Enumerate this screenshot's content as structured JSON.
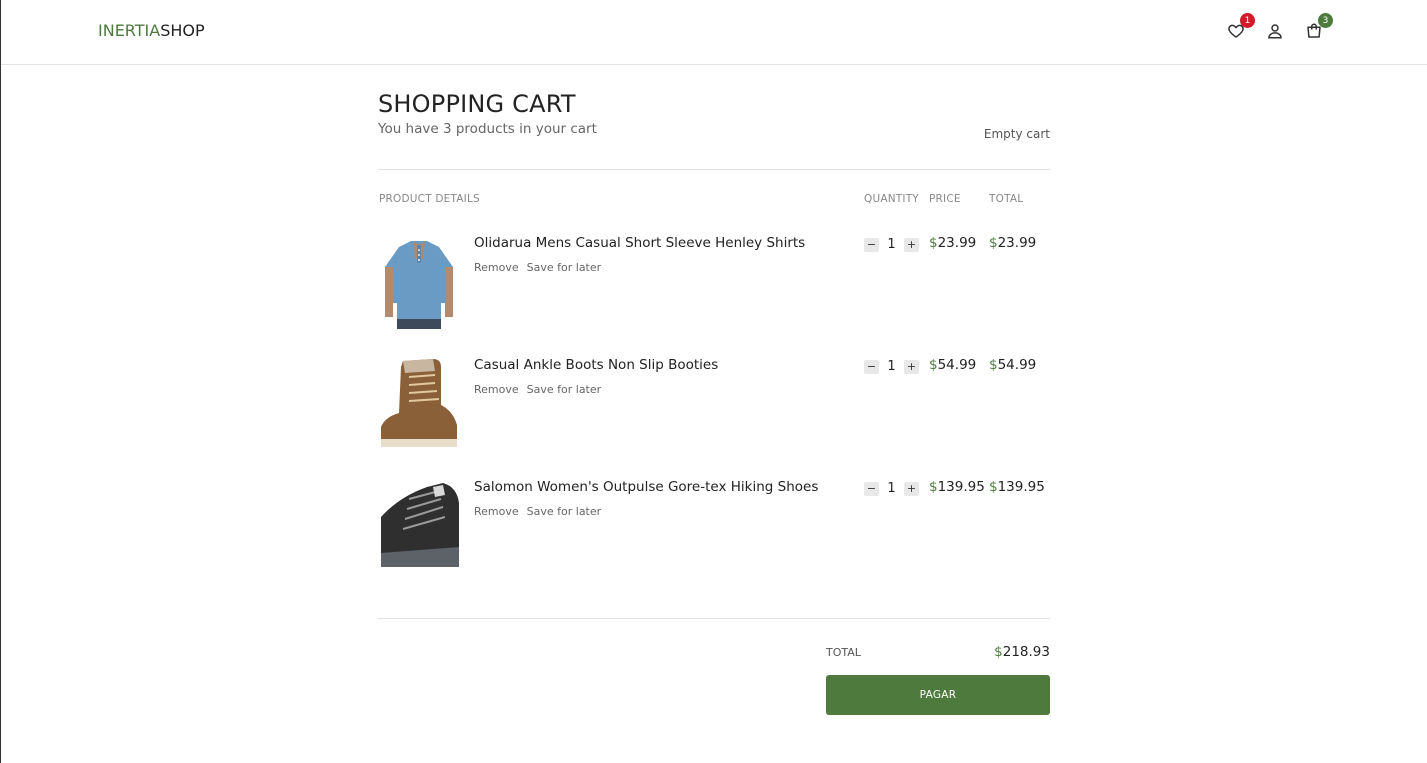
{
  "header": {
    "logo_part1": "INERTIA",
    "logo_part2": "SHOP",
    "wishlist_count": "1",
    "cart_count": "3",
    "icons": [
      "heart-icon",
      "user-icon",
      "shopping-bag-icon"
    ]
  },
  "cart": {
    "title": "SHOPPING CART",
    "subtitle": "You have 3 products in your cart",
    "empty_label": "Empty cart",
    "columns": {
      "product": "PRODUCT DETAILS",
      "quantity": "QUANTITY",
      "price": "PRICE",
      "total": "TOTAL"
    },
    "items": [
      {
        "name": "Olidarua Mens Casual Short Sleeve Henley Shirts",
        "remove": "Remove",
        "save": "Save for later",
        "qty": "1",
        "price": "23.99",
        "total": "23.99"
      },
      {
        "name": "Casual Ankle Boots Non Slip Booties",
        "remove": "Remove",
        "save": "Save for later",
        "qty": "1",
        "price": "54.99",
        "total": "54.99"
      },
      {
        "name": "Salomon Women's Outpulse Gore-tex Hiking Shoes",
        "remove": "Remove",
        "save": "Save for later",
        "qty": "1",
        "price": "139.95",
        "total": "139.95"
      }
    ],
    "currency": "$",
    "minus": "−",
    "plus": "+",
    "total_label": "TOTAL",
    "total_value": "218.93",
    "pay_label": "PAGAR"
  },
  "colors": {
    "accent": "#4e7a3e",
    "badge_red": "#d11a2a"
  }
}
